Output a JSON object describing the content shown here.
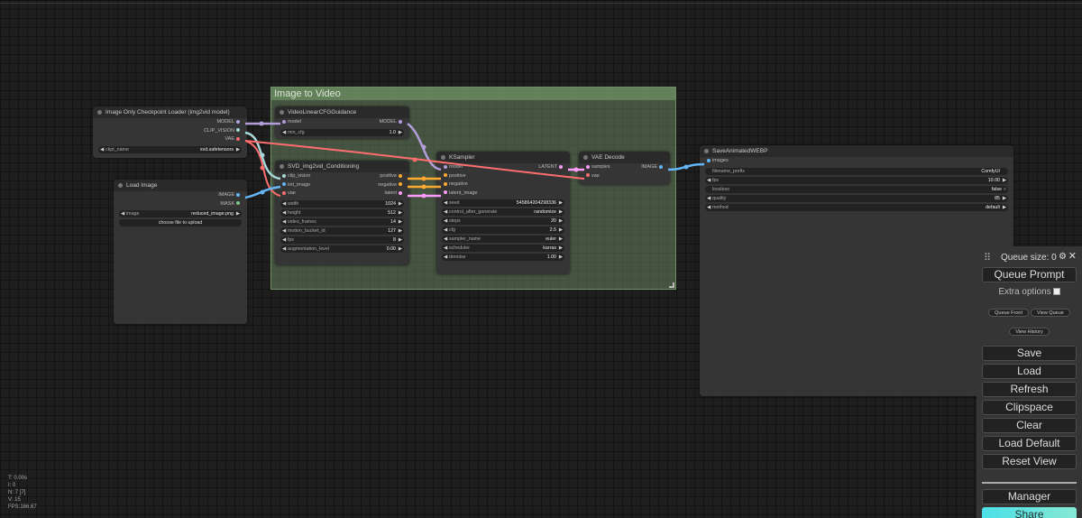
{
  "group": {
    "title": "Image to Video"
  },
  "nodes": {
    "checkpoint": {
      "title": "Image Only Checkpoint Loader (img2vid model)",
      "outputs": [
        "MODEL",
        "CLIP_VISION",
        "VAE"
      ],
      "widget": {
        "label": "ckpt_name",
        "value": "svd.safetensors"
      }
    },
    "load_image": {
      "title": "Load Image",
      "outputs": [
        "IMAGE",
        "MASK"
      ],
      "widget": {
        "label": "image",
        "value": "reduced_image.png"
      },
      "upload_label": "choose file to upload"
    },
    "cfg_guidance": {
      "title": "VideoLinearCFGGuidance",
      "input": "model",
      "output": "MODEL",
      "widget": {
        "label": "min_cfg",
        "value": "1.0"
      }
    },
    "conditioning": {
      "title": "SVD_img2vid_Conditioning",
      "inputs": [
        "clip_vision",
        "init_image",
        "vae"
      ],
      "outputs": [
        "positive",
        "negative",
        "latent"
      ],
      "widgets": [
        {
          "label": "width",
          "value": "1024"
        },
        {
          "label": "height",
          "value": "512"
        },
        {
          "label": "video_frames",
          "value": "14"
        },
        {
          "label": "motion_bucket_id",
          "value": "127"
        },
        {
          "label": "fps",
          "value": "8"
        },
        {
          "label": "augmentation_level",
          "value": "0.00"
        }
      ]
    },
    "ksampler": {
      "title": "KSampler",
      "inputs": [
        "model",
        "positive",
        "negative",
        "latent_image"
      ],
      "output": "LATENT",
      "widgets": [
        {
          "label": "seed",
          "value": "545864204298336"
        },
        {
          "label": "control_after_generate",
          "value": "randomize"
        },
        {
          "label": "steps",
          "value": "20"
        },
        {
          "label": "cfg",
          "value": "2.5"
        },
        {
          "label": "sampler_name",
          "value": "euler"
        },
        {
          "label": "scheduler",
          "value": "karras"
        },
        {
          "label": "denoise",
          "value": "1.00"
        }
      ]
    },
    "vae_decode": {
      "title": "VAE Decode",
      "inputs": [
        "samples",
        "vae"
      ],
      "output": "IMAGE"
    },
    "save_webp": {
      "title": "SaveAnimatedWEBP",
      "input": "images",
      "widgets": [
        {
          "label": "filename_prefix",
          "value": "ComfyUI"
        },
        {
          "label": "fps",
          "value": "10.00"
        },
        {
          "label": "lossless",
          "value": "false"
        },
        {
          "label": "quality",
          "value": "85"
        },
        {
          "label": "method",
          "value": "default"
        }
      ]
    }
  },
  "stats": [
    "T: 0.00s",
    "I: 0",
    "N: 7 [7]",
    "V: 15",
    "FPS:166.67"
  ],
  "menu": {
    "queue_size": "Queue size: 0",
    "queue_prompt": "Queue Prompt",
    "extra_options": "Extra options",
    "queue_front": "Queue Front",
    "view_queue": "View Queue",
    "view_history": "View History",
    "buttons": [
      "Save",
      "Load",
      "Refresh",
      "Clipspace",
      "Clear",
      "Load Default",
      "Reset View"
    ],
    "manager": "Manager",
    "share": "Share"
  },
  "colors": {
    "model": "#b39ddb",
    "clip_vision": "#a7d8d8",
    "vae": "#ff6e6e",
    "image": "#64b5f6",
    "conditioning": "#ffa931",
    "latent": "#ff9cf9"
  }
}
